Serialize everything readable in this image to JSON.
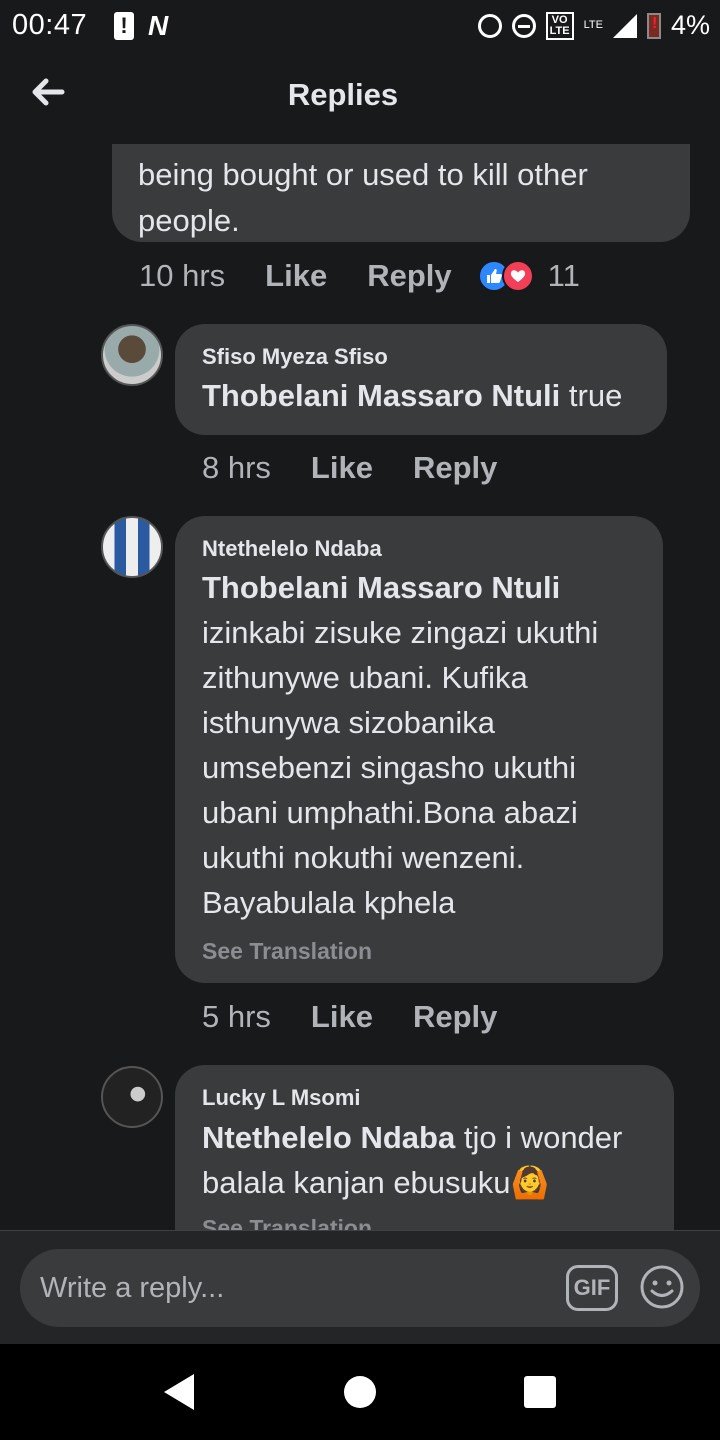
{
  "status_bar": {
    "time": "00:47",
    "volte_top": "VO",
    "volte_bottom": "LTE",
    "network": "LTE",
    "battery": "4%"
  },
  "header": {
    "title": "Replies"
  },
  "top_comment": {
    "text_line1": "being bought or used to kill other",
    "text_line2": "people.",
    "time": "10 hrs",
    "like": "Like",
    "reply": "Reply",
    "reaction_count": "11"
  },
  "replies": [
    {
      "author": "Sfiso Myeza Sfiso",
      "mention": "Thobelani Massaro Ntuli",
      "text": " true",
      "time": "8 hrs",
      "like": "Like",
      "reply": "Reply"
    },
    {
      "author": "Ntethelelo Ndaba",
      "mention": "Thobelani Massaro Ntuli",
      "lines": [
        "izinkabi zisuke zingazi ukuthi",
        "zithunywe ubani. Kufika",
        "isthunywa sizobanika",
        "umsebenzi singasho ukuthi",
        "ubani umphathi.Bona abazi",
        "ukuthi nokuthi wenzeni.",
        "Bayabulala kphela"
      ],
      "see_translation": "See Translation",
      "time": "5 hrs",
      "like": "Like",
      "reply": "Reply"
    },
    {
      "author": "Lucky L Msomi",
      "mention": "Ntethelelo Ndaba",
      "text_line1": " tjo i wonder",
      "text_line2": "balala kanjan ebusuku",
      "emoji": "🙆",
      "see_translation": "See Translation"
    }
  ],
  "composer": {
    "placeholder": "Write a reply...",
    "gif": "GIF"
  },
  "icons": {
    "back": "arrow-left-icon",
    "emoji": "smiley-icon",
    "like_reaction": "thumbs-up-icon",
    "love_reaction": "heart-icon"
  },
  "colors": {
    "background": "#18191a",
    "bubble": "#3a3b3c",
    "like_blue": "#2d88ff",
    "love_red": "#f33e58"
  }
}
